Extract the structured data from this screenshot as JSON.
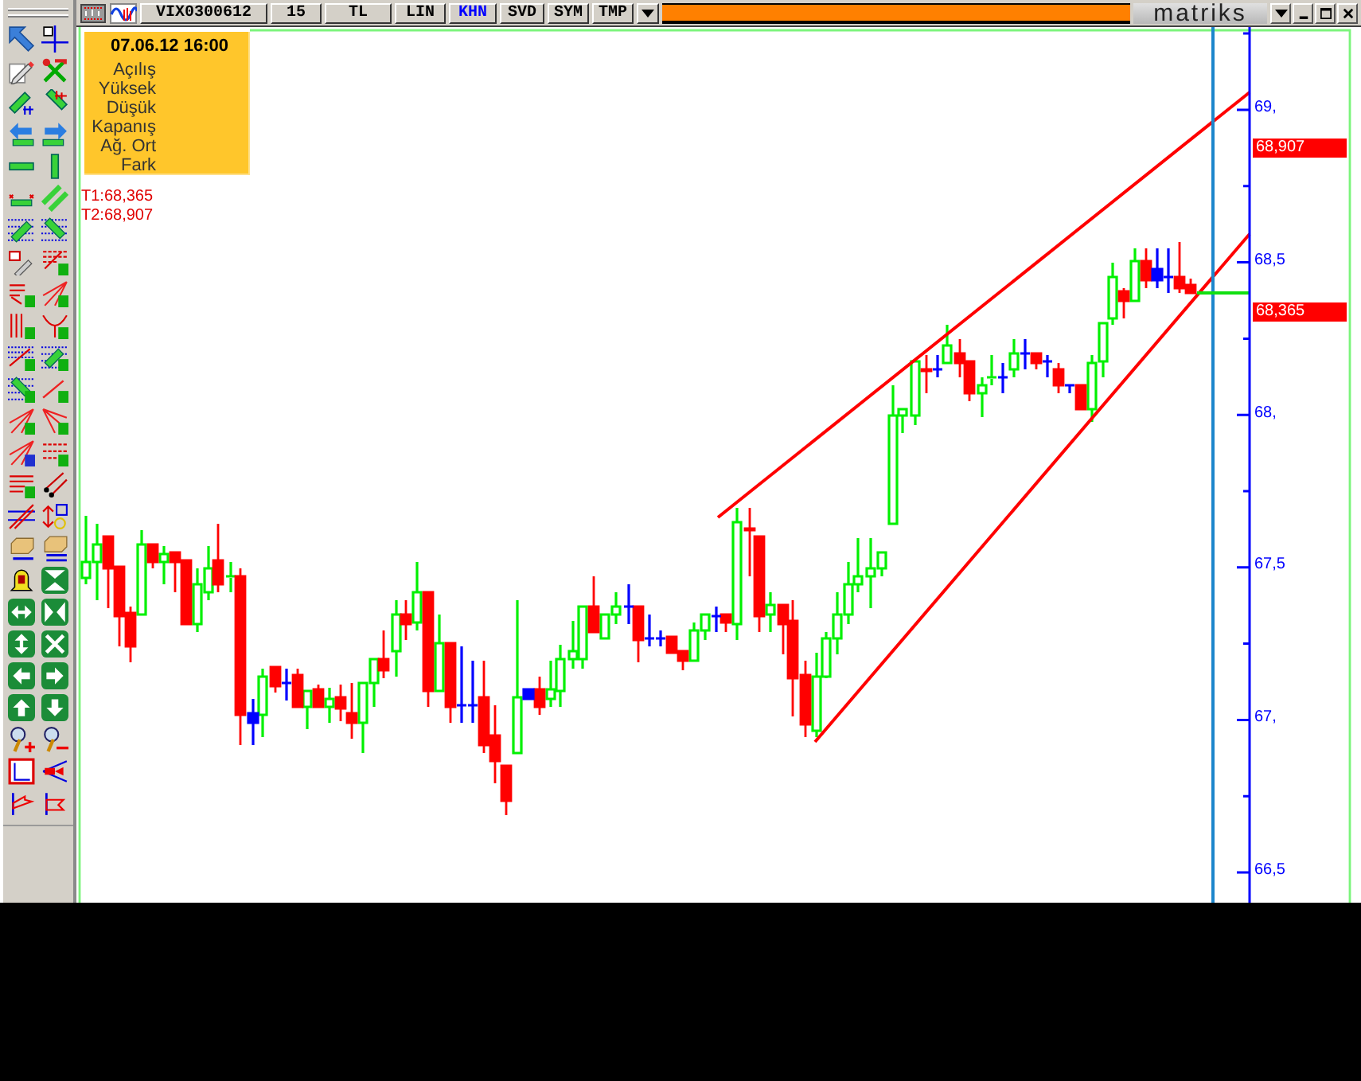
{
  "toolbar": {
    "symbol": "VIX0300612",
    "buttons": [
      {
        "label": "15",
        "selected": false
      },
      {
        "label": "TL",
        "selected": false
      },
      {
        "label": "LIN",
        "selected": false
      },
      {
        "label": "KHN",
        "selected": true
      },
      {
        "label": "SVD",
        "selected": false
      },
      {
        "label": "SYM",
        "selected": false
      },
      {
        "label": "TMP",
        "selected": false
      }
    ]
  },
  "brand": "matriks",
  "info_panel": {
    "date": "07.06.12 16:00",
    "fields": [
      "Açılış",
      "Yüksek",
      "Düşük",
      "Kapanış",
      "Ağ. Ort",
      "Fark"
    ]
  },
  "trend_labels": [
    "T1:68,365",
    "T2:68,907"
  ],
  "price_axis": {
    "labels": [
      "69,",
      "68,5",
      "68,",
      "67,5",
      "67,",
      "66,5"
    ],
    "markers": [
      "68,907",
      "68,365"
    ]
  }
}
